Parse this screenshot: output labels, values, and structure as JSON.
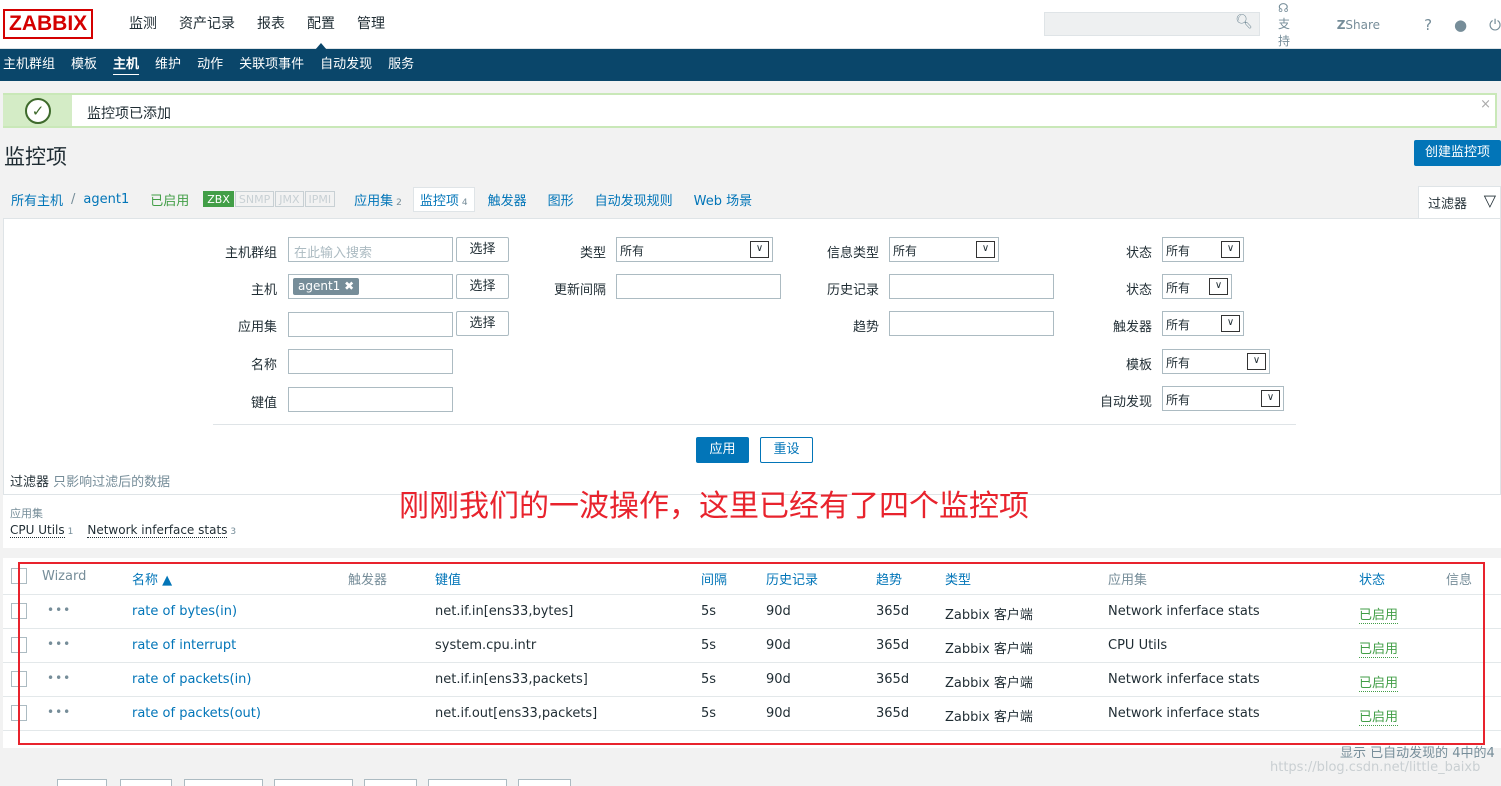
{
  "header": {
    "logo": "ZABBIX",
    "nav": [
      "监测",
      "资产记录",
      "报表",
      "配置",
      "管理"
    ],
    "active_nav": "配置",
    "links": {
      "support": "支持",
      "share": "Share",
      "help": "?"
    }
  },
  "subnav": {
    "items": [
      "主机群组",
      "模板",
      "主机",
      "维护",
      "动作",
      "关联项事件",
      "自动发现",
      "服务"
    ],
    "active": "主机"
  },
  "message": {
    "text": "监控项已添加",
    "close": "×"
  },
  "page": {
    "title": "监控项",
    "create_button": "创建监控项"
  },
  "breadcrumb": {
    "all_hosts": "所有主机",
    "sep": "/",
    "host": "agent1",
    "enabled": "已启用",
    "tags": [
      "ZBX",
      "SNMP",
      "JMX",
      "IPMI"
    ],
    "tabs": [
      {
        "label": "应用集",
        "count": "2"
      },
      {
        "label": "监控项",
        "count": "4"
      },
      {
        "label": "触发器",
        "count": ""
      },
      {
        "label": "图形",
        "count": ""
      },
      {
        "label": "自动发现规则",
        "count": ""
      },
      {
        "label": "Web 场景",
        "count": ""
      }
    ]
  },
  "filter_tab": {
    "label": "过滤器"
  },
  "filter": {
    "host_group_label": "主机群组",
    "host_group_placeholder": "在此输入搜索",
    "select": "选择",
    "host_label": "主机",
    "host_chip": "agent1",
    "app_label": "应用集",
    "name_label": "名称",
    "key_label": "键值",
    "type_label": "类型",
    "type_value": "所有",
    "interval_label": "更新间隔",
    "info_type_label": "信息类型",
    "info_type_value": "所有",
    "history_label": "历史记录",
    "trends_label": "趋势",
    "status_label": "状态",
    "status_value": "所有",
    "state_label": "状态",
    "state_value": "所有",
    "triggers_label": "触发器",
    "triggers_value": "所有",
    "template_label": "模板",
    "template_value": "所有",
    "discovery_label": "自动发现",
    "discovery_value": "所有",
    "apply": "应用",
    "reset": "重设",
    "note_title": "过滤器",
    "note_text": "只影响过滤后的数据"
  },
  "apps": {
    "header": "应用集",
    "items": [
      {
        "name": "CPU Utils",
        "count": "1"
      },
      {
        "name": "Network inferface stats",
        "count": "3"
      }
    ]
  },
  "annotation": "刚刚我们的一波操作，这里已经有了四个监控项",
  "table": {
    "headers": {
      "wizard": "Wizard",
      "name": "名称 ▲",
      "triggers": "触发器",
      "key": "键值",
      "interval": "间隔",
      "history": "历史记录",
      "trends": "趋势",
      "type": "类型",
      "apps": "应用集",
      "status": "状态",
      "info": "信息"
    },
    "rows": [
      {
        "name": "rate of bytes(in)",
        "key": "net.if.in[ens33,bytes]",
        "interval": "5s",
        "history": "90d",
        "trends": "365d",
        "type": "Zabbix 客户端",
        "app": "Network inferface stats",
        "status": "已启用"
      },
      {
        "name": "rate of interrupt",
        "key": "system.cpu.intr",
        "interval": "5s",
        "history": "90d",
        "trends": "365d",
        "type": "Zabbix 客户端",
        "app": "CPU Utils",
        "status": "已启用"
      },
      {
        "name": "rate of packets(in)",
        "key": "net.if.in[ens33,packets]",
        "interval": "5s",
        "history": "90d",
        "trends": "365d",
        "type": "Zabbix 客户端",
        "app": "Network inferface stats",
        "status": "已启用"
      },
      {
        "name": "rate of packets(out)",
        "key": "net.if.out[ens33,packets]",
        "interval": "5s",
        "history": "90d",
        "trends": "365d",
        "type": "Zabbix 客户端",
        "app": "Network inferface stats",
        "status": "已启用"
      }
    ],
    "footer": "显示 已自动发现的 4中的4"
  },
  "watermark": "https://blog.csdn.net/little_baixb"
}
